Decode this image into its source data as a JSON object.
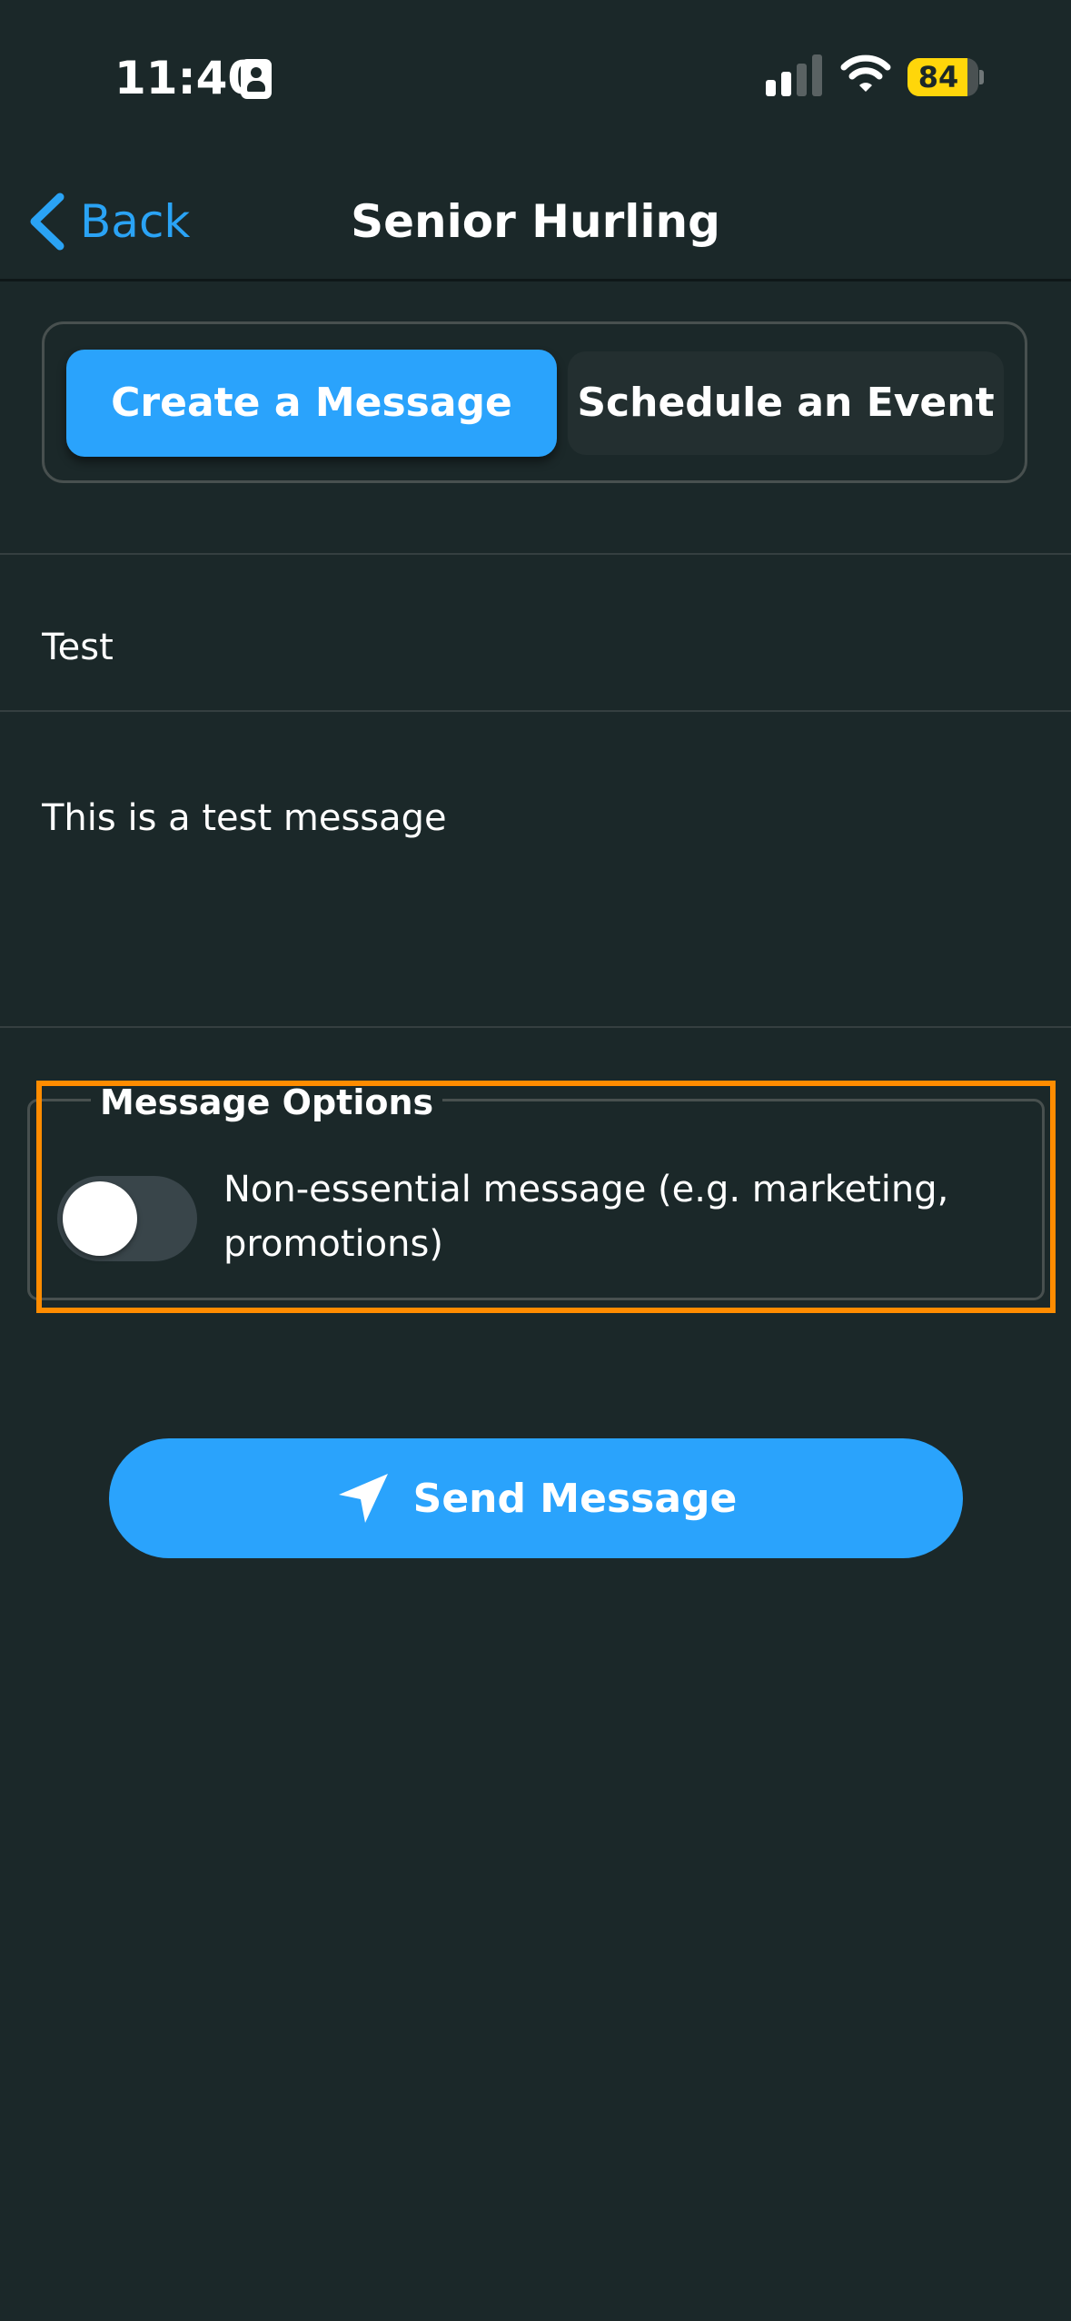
{
  "status_bar": {
    "time": "11:40",
    "battery_percent": "84",
    "battery_level": 0.84,
    "icons": [
      "contact-card-icon",
      "cellular-signal-icon",
      "wifi-icon",
      "battery-icon"
    ]
  },
  "nav": {
    "back_label": "Back",
    "title": "Senior Hurling"
  },
  "segments": {
    "active_label": "Create a Message",
    "inactive_label": "Schedule an Event"
  },
  "form": {
    "subject_value": "Test",
    "body_value": "This is a test message"
  },
  "options": {
    "legend": "Message Options",
    "non_essential_label": "Non-essential message (e.g. marketing, promotions)",
    "non_essential_enabled": false
  },
  "send_label": "Send Message",
  "colors": {
    "background": "#1b2829",
    "accent": "#2aa3fc",
    "highlight": "#ff8c00",
    "battery": "#ffd60a"
  }
}
